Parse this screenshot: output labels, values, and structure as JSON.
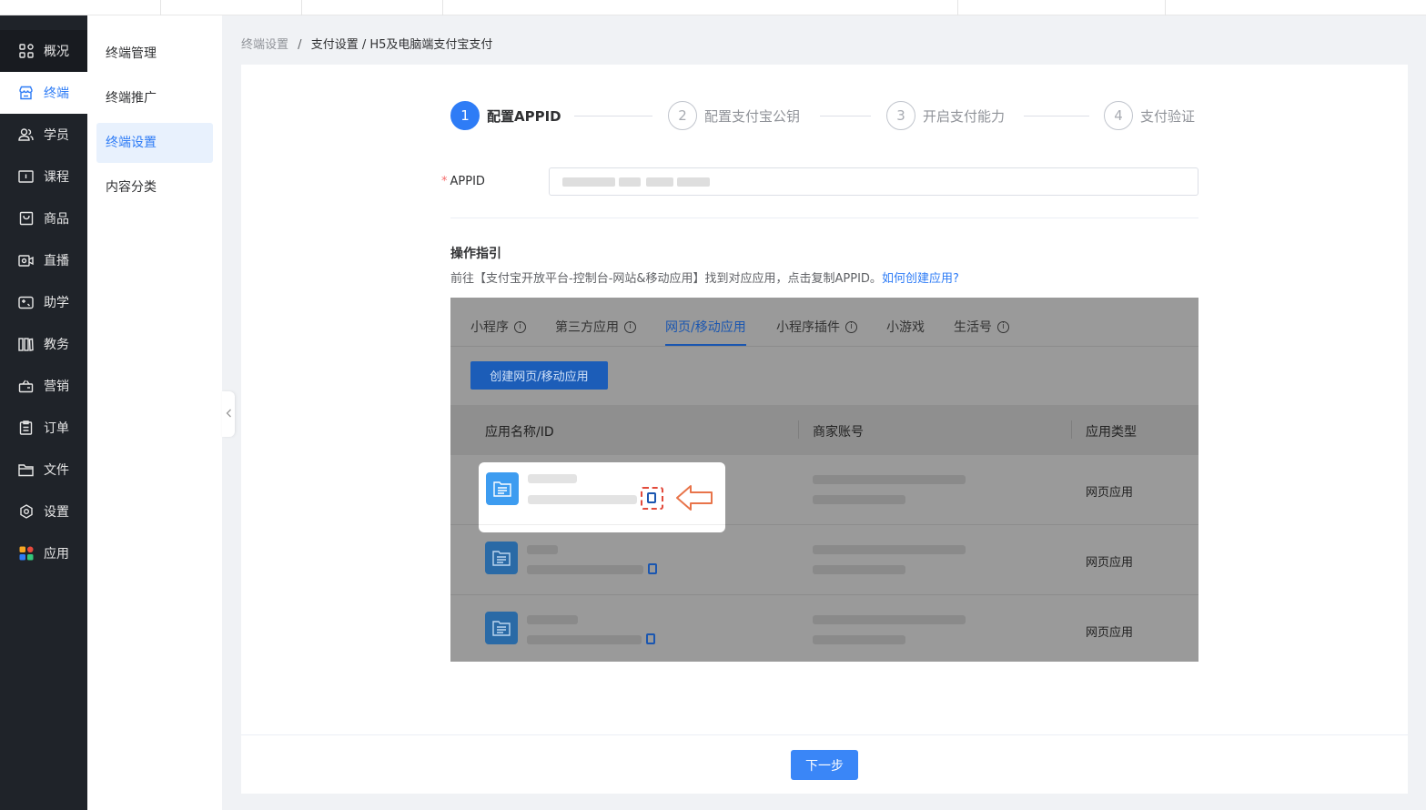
{
  "nav": {
    "items": [
      {
        "label": "概况",
        "icon": "grid-icon"
      },
      {
        "label": "终端",
        "icon": "store-icon"
      },
      {
        "label": "学员",
        "icon": "users-icon"
      },
      {
        "label": "课程",
        "icon": "course-icon"
      },
      {
        "label": "商品",
        "icon": "bag-icon"
      },
      {
        "label": "直播",
        "icon": "camera-icon"
      },
      {
        "label": "助学",
        "icon": "gamepad-icon"
      },
      {
        "label": "教务",
        "icon": "books-icon"
      },
      {
        "label": "营销",
        "icon": "gift-icon"
      },
      {
        "label": "订单",
        "icon": "clipboard-icon"
      },
      {
        "label": "文件",
        "icon": "folder-icon"
      },
      {
        "label": "设置",
        "icon": "gear-icon"
      },
      {
        "label": "应用",
        "icon": "apps-icon"
      }
    ],
    "active_index": 1,
    "accent": "#2e7cf6"
  },
  "submenu": {
    "items": [
      "终端管理",
      "终端推广",
      "终端设置",
      "内容分类"
    ],
    "active_index": 2
  },
  "breadcrumb": {
    "root": "终端设置",
    "separator": "/",
    "current": "支付设置 / H5及电脑端支付宝支付"
  },
  "steps": [
    {
      "num": "1",
      "label": "配置APPID"
    },
    {
      "num": "2",
      "label": "配置支付宝公钥"
    },
    {
      "num": "3",
      "label": "开启支付能力"
    },
    {
      "num": "4",
      "label": "支付验证"
    }
  ],
  "form": {
    "required_mark": "*",
    "appid_label": "APPID"
  },
  "guide": {
    "title": "操作指引",
    "desc": "前往【支付宝开放平台-控制台-网站&移动应用】找到对应应用，点击复制APPID。",
    "link": "如何创建应用?"
  },
  "illustration": {
    "tabs": [
      {
        "label": "小程序",
        "info": true
      },
      {
        "label": "第三方应用",
        "info": true
      },
      {
        "label": "网页/移动应用",
        "info": false
      },
      {
        "label": "小程序插件",
        "info": true
      },
      {
        "label": "小游戏",
        "info": false
      },
      {
        "label": "生活号",
        "info": true
      }
    ],
    "active_tab": 2,
    "create_button": "创建网页/移动应用",
    "columns": [
      "应用名称/ID",
      "商家账号",
      "应用类型"
    ],
    "rows": [
      {
        "type": "网页应用"
      },
      {
        "type": "网页应用"
      },
      {
        "type": "网页应用"
      }
    ],
    "info_glyph": "i"
  },
  "footer": {
    "next_label": "下一步"
  }
}
